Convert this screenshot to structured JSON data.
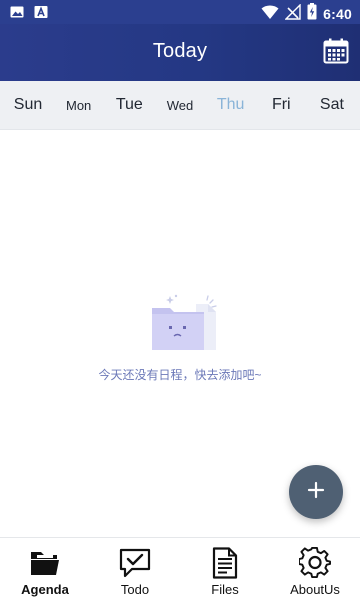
{
  "status_bar": {
    "time": "6:40",
    "left_icons": [
      "image-icon",
      "text-a-icon"
    ],
    "right_icons": [
      "wifi-icon",
      "no-signal-icon",
      "battery-charging-icon"
    ]
  },
  "header": {
    "title": "Today",
    "calendar_icon": "calendar-icon",
    "background": "#263a87"
  },
  "week": {
    "days": [
      {
        "label": "Sun",
        "active": false
      },
      {
        "label": "Mon",
        "active": false
      },
      {
        "label": "Tue",
        "active": false
      },
      {
        "label": "Wed",
        "active": false
      },
      {
        "label": "Thu",
        "active": true
      },
      {
        "label": "Fri",
        "active": false
      },
      {
        "label": "Sat",
        "active": false
      }
    ],
    "active_color": "#8ab4d8"
  },
  "empty_state": {
    "icon": "empty-folder-icon",
    "message": "今天还没有日程，快去添加吧~",
    "message_color": "#6c79b8"
  },
  "fab": {
    "icon": "plus-icon",
    "color": "#4f6073"
  },
  "bottom_nav": {
    "items": [
      {
        "label": "Agenda",
        "icon": "folder-icon",
        "active": true
      },
      {
        "label": "Todo",
        "icon": "chat-check-icon",
        "active": false
      },
      {
        "label": "Files",
        "icon": "document-icon",
        "active": false
      },
      {
        "label": "AboutUs",
        "icon": "gear-icon",
        "active": false
      }
    ]
  }
}
